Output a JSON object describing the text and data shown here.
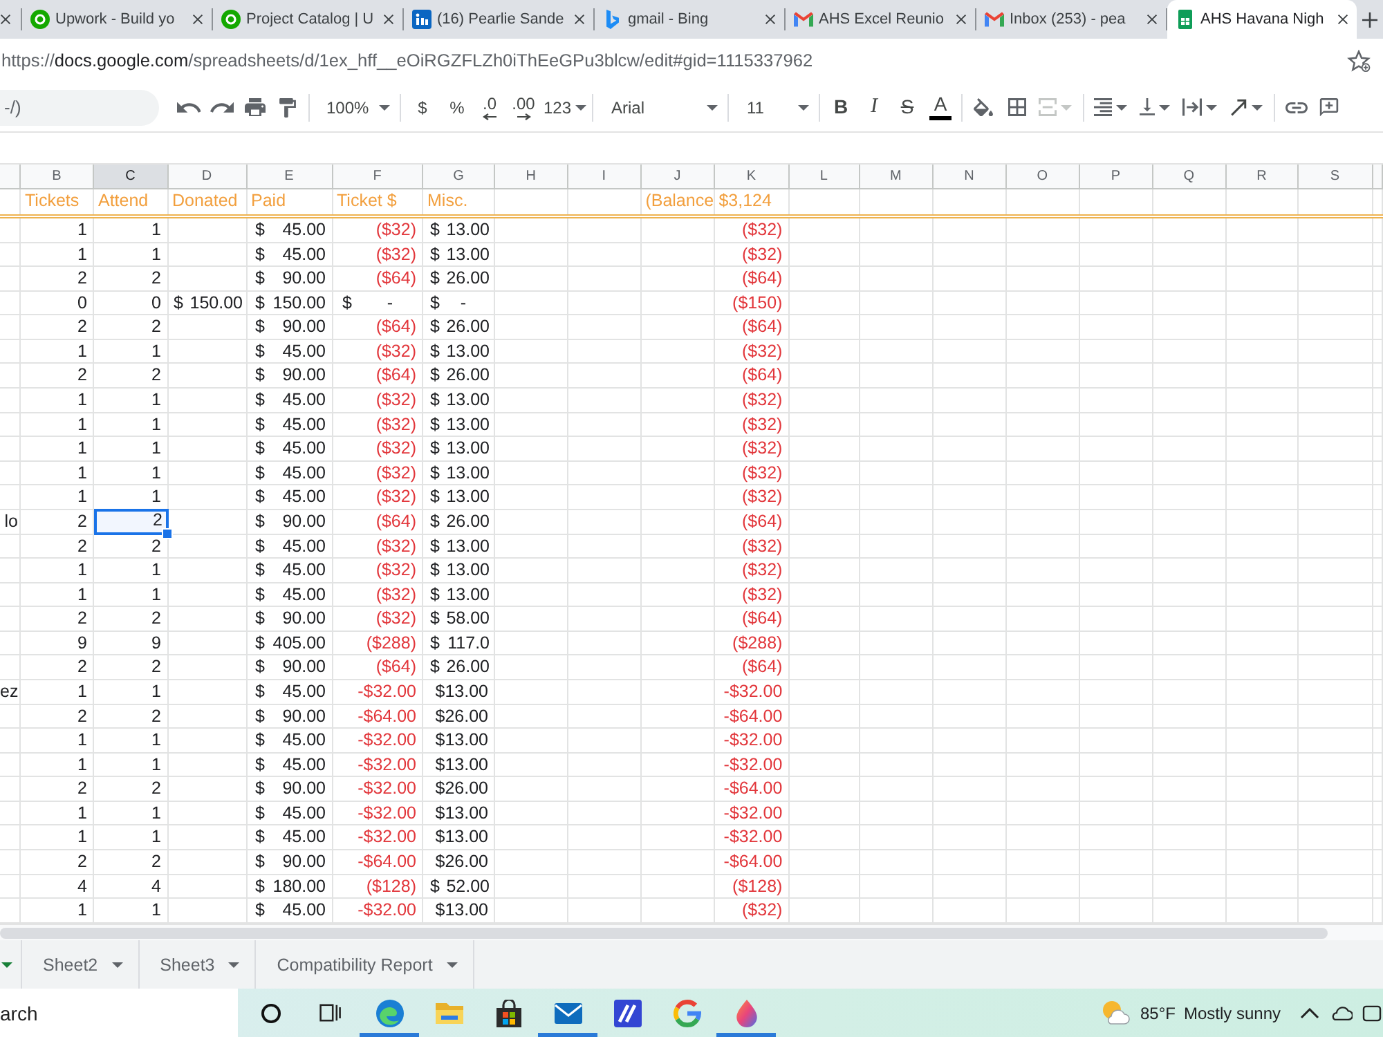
{
  "browser": {
    "tabs": [
      {
        "kind": "partial",
        "selected": false
      },
      {
        "title": "Upwork - Build yo",
        "kind": "circle",
        "selected": false
      },
      {
        "title": "Project Catalog | U",
        "kind": "circle",
        "selected": false
      },
      {
        "title": "(16) Pearlie Sande",
        "kind": "square",
        "selected": false
      },
      {
        "title": "gmail - Bing",
        "kind": "ribbon",
        "selected": false
      },
      {
        "title": "AHS Excel Reunio",
        "kind": "envelope",
        "selected": false
      },
      {
        "title": "Inbox (253) - pea",
        "kind": "envelope",
        "selected": false
      },
      {
        "title": "AHS Havana Nigh",
        "kind": "sheet",
        "selected": true
      }
    ],
    "address": {
      "scheme": "https://",
      "host": "docs.google.com",
      "path": "/spreadsheets/d/1ex_hff__eOiRGZFLZh0iThEeGPu3blcw/edit#gid=1115337962"
    }
  },
  "toolbar": {
    "menu_search": {
      "placeholder": "-/)"
    },
    "zoom": "100%",
    "number_formats": [
      {
        "label": "$",
        "kind": "plain"
      },
      {
        "label": "%",
        "kind": "plain"
      },
      {
        "label": ".0",
        "kind": "decrease"
      },
      {
        "label": ".00",
        "kind": "increase"
      },
      {
        "label": "123",
        "kind": "menu"
      }
    ],
    "font": "Arial",
    "font_size": "11",
    "text_styles": [
      {
        "label": "B",
        "kind": "bold"
      },
      {
        "label": "I",
        "kind": "italic"
      },
      {
        "label": "S",
        "kind": "strike"
      },
      {
        "label": "A",
        "kind": "color"
      }
    ],
    "merge": {
      "disabled": true
    }
  },
  "sheet": {
    "column_headers": [
      {
        "letter": "B",
        "selected": false
      },
      {
        "letter": "C",
        "selected": true
      },
      {
        "letter": "D",
        "selected": false
      },
      {
        "letter": "E",
        "selected": false
      },
      {
        "letter": "F",
        "selected": false
      },
      {
        "letter": "G",
        "selected": false
      },
      {
        "letter": "H",
        "selected": false
      },
      {
        "letter": "I",
        "selected": false
      },
      {
        "letter": "J",
        "selected": false
      },
      {
        "letter": "K",
        "selected": false
      },
      {
        "letter": "L",
        "selected": false
      },
      {
        "letter": "M",
        "selected": false
      },
      {
        "letter": "N",
        "selected": false
      },
      {
        "letter": "O",
        "selected": false
      },
      {
        "letter": "P",
        "selected": false
      },
      {
        "letter": "Q",
        "selected": false
      },
      {
        "letter": "R",
        "selected": false
      },
      {
        "letter": "S",
        "selected": false
      }
    ],
    "header_row": {
      "tickets": "Tickets",
      "attend": "Attend",
      "donated": "Donated",
      "paid": "Paid",
      "ticket_cost": "Ticket $",
      "misc": "Misc.",
      "balance_label": "(Balance",
      "balance": "$3,124"
    },
    "rows": [
      {
        "tickets": {
          "text": "1",
          "kind": "number",
          "selected": false
        },
        "attend": {
          "text": "1",
          "kind": "number",
          "selected": false
        },
        "paid": {
          "text": "$ 45.00",
          "kind": "accounting",
          "selected": false
        },
        "ticket_cost": {
          "text": "($32)",
          "kind": "negative",
          "selected": false
        },
        "misc": {
          "text": "$ 13.00",
          "kind": "accounting",
          "selected": false
        },
        "balance": {
          "text": "($32)",
          "kind": "negative",
          "selected": false
        }
      },
      {
        "tickets": {
          "text": "1",
          "kind": "number",
          "selected": false
        },
        "attend": {
          "text": "1",
          "kind": "number",
          "selected": false
        },
        "paid": {
          "text": "$ 45.00",
          "kind": "accounting",
          "selected": false
        },
        "ticket_cost": {
          "text": "($32)",
          "kind": "negative",
          "selected": false
        },
        "misc": {
          "text": "$ 13.00",
          "kind": "accounting",
          "selected": false
        },
        "balance": {
          "text": "($32)",
          "kind": "negative",
          "selected": false
        }
      },
      {
        "tickets": {
          "text": "2",
          "kind": "number",
          "selected": false
        },
        "attend": {
          "text": "2",
          "kind": "number",
          "selected": false
        },
        "paid": {
          "text": "$ 90.00",
          "kind": "accounting",
          "selected": false
        },
        "ticket_cost": {
          "text": "($64)",
          "kind": "negative",
          "selected": false
        },
        "misc": {
          "text": "$ 26.00",
          "kind": "accounting",
          "selected": false
        },
        "balance": {
          "text": "($64)",
          "kind": "negative",
          "selected": false
        }
      },
      {
        "tickets": {
          "text": "0",
          "kind": "number",
          "selected": false
        },
        "attend": {
          "text": "0",
          "kind": "number",
          "selected": false
        },
        "donated": {
          "text": "$ 150.00",
          "kind": "accounting",
          "selected": false
        },
        "paid": {
          "text": "$ 150.00",
          "kind": "accounting",
          "selected": false
        },
        "ticket_cost": {
          "text": "$ -",
          "kind": "zero",
          "selected": false
        },
        "misc": {
          "text": "$ -",
          "kind": "zero",
          "selected": false
        },
        "balance": {
          "text": "($150)",
          "kind": "negative",
          "selected": false
        }
      },
      {
        "tickets": {
          "text": "2",
          "kind": "number",
          "selected": false
        },
        "attend": {
          "text": "2",
          "kind": "number",
          "selected": false
        },
        "paid": {
          "text": "$ 90.00",
          "kind": "accounting",
          "selected": false
        },
        "ticket_cost": {
          "text": "($64)",
          "kind": "negative",
          "selected": false
        },
        "misc": {
          "text": "$ 26.00",
          "kind": "accounting",
          "selected": false
        },
        "balance": {
          "text": "($64)",
          "kind": "negative",
          "selected": false
        }
      },
      {
        "tickets": {
          "text": "1",
          "kind": "number",
          "selected": false
        },
        "attend": {
          "text": "1",
          "kind": "number",
          "selected": false
        },
        "paid": {
          "text": "$ 45.00",
          "kind": "accounting",
          "selected": false
        },
        "ticket_cost": {
          "text": "($32)",
          "kind": "negative",
          "selected": false
        },
        "misc": {
          "text": "$ 13.00",
          "kind": "accounting",
          "selected": false
        },
        "balance": {
          "text": "($32)",
          "kind": "negative",
          "selected": false
        }
      },
      {
        "tickets": {
          "text": "2",
          "kind": "number",
          "selected": false
        },
        "attend": {
          "text": "2",
          "kind": "number",
          "selected": false
        },
        "paid": {
          "text": "$ 90.00",
          "kind": "accounting",
          "selected": false
        },
        "ticket_cost": {
          "text": "($64)",
          "kind": "negative",
          "selected": false
        },
        "misc": {
          "text": "$ 26.00",
          "kind": "accounting",
          "selected": false
        },
        "balance": {
          "text": "($64)",
          "kind": "negative",
          "selected": false
        }
      },
      {
        "tickets": {
          "text": "1",
          "kind": "number",
          "selected": false
        },
        "attend": {
          "text": "1",
          "kind": "number",
          "selected": false
        },
        "paid": {
          "text": "$ 45.00",
          "kind": "accounting",
          "selected": false
        },
        "ticket_cost": {
          "text": "($32)",
          "kind": "negative",
          "selected": false
        },
        "misc": {
          "text": "$ 13.00",
          "kind": "accounting",
          "selected": false
        },
        "balance": {
          "text": "($32)",
          "kind": "negative",
          "selected": false
        }
      },
      {
        "tickets": {
          "text": "1",
          "kind": "number",
          "selected": false
        },
        "attend": {
          "text": "1",
          "kind": "number",
          "selected": false
        },
        "paid": {
          "text": "$ 45.00",
          "kind": "accounting",
          "selected": false
        },
        "ticket_cost": {
          "text": "($32)",
          "kind": "negative",
          "selected": false
        },
        "misc": {
          "text": "$ 13.00",
          "kind": "accounting",
          "selected": false
        },
        "balance": {
          "text": "($32)",
          "kind": "negative",
          "selected": false
        }
      },
      {
        "tickets": {
          "text": "1",
          "kind": "number",
          "selected": false
        },
        "attend": {
          "text": "1",
          "kind": "number",
          "selected": false
        },
        "paid": {
          "text": "$ 45.00",
          "kind": "accounting",
          "selected": false
        },
        "ticket_cost": {
          "text": "($32)",
          "kind": "negative",
          "selected": false
        },
        "misc": {
          "text": "$ 13.00",
          "kind": "accounting",
          "selected": false
        },
        "balance": {
          "text": "($32)",
          "kind": "negative",
          "selected": false
        }
      },
      {
        "tickets": {
          "text": "1",
          "kind": "number",
          "selected": false
        },
        "attend": {
          "text": "1",
          "kind": "number",
          "selected": false
        },
        "paid": {
          "text": "$ 45.00",
          "kind": "accounting",
          "selected": false
        },
        "ticket_cost": {
          "text": "($32)",
          "kind": "negative",
          "selected": false
        },
        "misc": {
          "text": "$ 13.00",
          "kind": "accounting",
          "selected": false
        },
        "balance": {
          "text": "($32)",
          "kind": "negative",
          "selected": false
        }
      },
      {
        "tickets": {
          "text": "1",
          "kind": "number",
          "selected": false
        },
        "attend": {
          "text": "1",
          "kind": "number",
          "selected": false
        },
        "paid": {
          "text": "$ 45.00",
          "kind": "accounting",
          "selected": false
        },
        "ticket_cost": {
          "text": "($32)",
          "kind": "negative",
          "selected": false
        },
        "misc": {
          "text": "$ 13.00",
          "kind": "accounting",
          "selected": false
        },
        "balance": {
          "text": "($32)",
          "kind": "negative",
          "selected": false
        }
      },
      {
        "column_a": "lo",
        "tickets": {
          "text": "2",
          "kind": "number",
          "selected": false
        },
        "attend": {
          "text": "2",
          "kind": "number",
          "selected": true
        },
        "paid": {
          "text": "$ 90.00",
          "kind": "accounting",
          "selected": false
        },
        "ticket_cost": {
          "text": "($64)",
          "kind": "negative",
          "selected": false
        },
        "misc": {
          "text": "$ 26.00",
          "kind": "accounting",
          "selected": false
        },
        "balance": {
          "text": "($64)",
          "kind": "negative",
          "selected": false
        }
      },
      {
        "tickets": {
          "text": "2",
          "kind": "number",
          "selected": false
        },
        "attend": {
          "text": "2",
          "kind": "number",
          "selected": false
        },
        "paid": {
          "text": "$ 45.00",
          "kind": "accounting",
          "selected": false
        },
        "ticket_cost": {
          "text": "($32)",
          "kind": "negative",
          "selected": false
        },
        "misc": {
          "text": "$ 13.00",
          "kind": "accounting",
          "selected": false
        },
        "balance": {
          "text": "($32)",
          "kind": "negative",
          "selected": false
        }
      },
      {
        "tickets": {
          "text": "1",
          "kind": "number",
          "selected": false
        },
        "attend": {
          "text": "1",
          "kind": "number",
          "selected": false
        },
        "paid": {
          "text": "$ 45.00",
          "kind": "accounting",
          "selected": false
        },
        "ticket_cost": {
          "text": "($32)",
          "kind": "negative",
          "selected": false
        },
        "misc": {
          "text": "$ 13.00",
          "kind": "accounting",
          "selected": false
        },
        "balance": {
          "text": "($32)",
          "kind": "negative",
          "selected": false
        }
      },
      {
        "tickets": {
          "text": "1",
          "kind": "number",
          "selected": false
        },
        "attend": {
          "text": "1",
          "kind": "number",
          "selected": false
        },
        "paid": {
          "text": "$ 45.00",
          "kind": "accounting",
          "selected": false
        },
        "ticket_cost": {
          "text": "($32)",
          "kind": "negative",
          "selected": false
        },
        "misc": {
          "text": "$ 13.00",
          "kind": "accounting",
          "selected": false
        },
        "balance": {
          "text": "($32)",
          "kind": "negative",
          "selected": false
        }
      },
      {
        "tickets": {
          "text": "2",
          "kind": "number",
          "selected": false
        },
        "attend": {
          "text": "2",
          "kind": "number",
          "selected": false
        },
        "paid": {
          "text": "$ 90.00",
          "kind": "accounting",
          "selected": false
        },
        "ticket_cost": {
          "text": "($32)",
          "kind": "negative",
          "selected": false
        },
        "misc": {
          "text": "$ 58.00",
          "kind": "accounting",
          "selected": false
        },
        "balance": {
          "text": "($64)",
          "kind": "negative",
          "selected": false
        }
      },
      {
        "tickets": {
          "text": "9",
          "kind": "number",
          "selected": false
        },
        "attend": {
          "text": "9",
          "kind": "number",
          "selected": false
        },
        "paid": {
          "text": "$ 405.00",
          "kind": "accounting",
          "selected": false
        },
        "ticket_cost": {
          "text": "($288)",
          "kind": "negative",
          "selected": false
        },
        "misc": {
          "text": "$ 117.0",
          "kind": "accounting",
          "selected": false
        },
        "balance": {
          "text": "($288)",
          "kind": "negative",
          "selected": false
        }
      },
      {
        "tickets": {
          "text": "2",
          "kind": "number",
          "selected": false
        },
        "attend": {
          "text": "2",
          "kind": "number",
          "selected": false
        },
        "paid": {
          "text": "$ 90.00",
          "kind": "accounting",
          "selected": false
        },
        "ticket_cost": {
          "text": "($64)",
          "kind": "negative",
          "selected": false
        },
        "misc": {
          "text": "$ 26.00",
          "kind": "accounting",
          "selected": false
        },
        "balance": {
          "text": "($64)",
          "kind": "negative",
          "selected": false
        }
      },
      {
        "column_a": "ez",
        "tickets": {
          "text": "1",
          "kind": "number",
          "selected": false
        },
        "attend": {
          "text": "1",
          "kind": "number",
          "selected": false
        },
        "paid": {
          "text": "$ 45.00",
          "kind": "accounting",
          "selected": false
        },
        "ticket_cost": {
          "text": "-$32.00",
          "kind": "negative",
          "selected": false
        },
        "misc": {
          "text": "$13.00",
          "kind": "number",
          "selected": false
        },
        "balance": {
          "text": "-$32.00",
          "kind": "negative",
          "selected": false
        }
      },
      {
        "tickets": {
          "text": "2",
          "kind": "number",
          "selected": false
        },
        "attend": {
          "text": "2",
          "kind": "number",
          "selected": false
        },
        "paid": {
          "text": "$ 90.00",
          "kind": "accounting",
          "selected": false
        },
        "ticket_cost": {
          "text": "-$64.00",
          "kind": "negative",
          "selected": false
        },
        "misc": {
          "text": "$26.00",
          "kind": "number",
          "selected": false
        },
        "balance": {
          "text": "-$64.00",
          "kind": "negative",
          "selected": false
        }
      },
      {
        "tickets": {
          "text": "1",
          "kind": "number",
          "selected": false
        },
        "attend": {
          "text": "1",
          "kind": "number",
          "selected": false
        },
        "paid": {
          "text": "$ 45.00",
          "kind": "accounting",
          "selected": false
        },
        "ticket_cost": {
          "text": "-$32.00",
          "kind": "negative",
          "selected": false
        },
        "misc": {
          "text": "$13.00",
          "kind": "number",
          "selected": false
        },
        "balance": {
          "text": "-$32.00",
          "kind": "negative",
          "selected": false
        }
      },
      {
        "tickets": {
          "text": "1",
          "kind": "number",
          "selected": false
        },
        "attend": {
          "text": "1",
          "kind": "number",
          "selected": false
        },
        "paid": {
          "text": "$ 45.00",
          "kind": "accounting",
          "selected": false
        },
        "ticket_cost": {
          "text": "-$32.00",
          "kind": "negative",
          "selected": false
        },
        "misc": {
          "text": "$13.00",
          "kind": "number",
          "selected": false
        },
        "balance": {
          "text": "-$32.00",
          "kind": "negative",
          "selected": false
        }
      },
      {
        "tickets": {
          "text": "2",
          "kind": "number",
          "selected": false
        },
        "attend": {
          "text": "2",
          "kind": "number",
          "selected": false
        },
        "paid": {
          "text": "$ 90.00",
          "kind": "accounting",
          "selected": false
        },
        "ticket_cost": {
          "text": "-$32.00",
          "kind": "negative",
          "selected": false
        },
        "misc": {
          "text": "$26.00",
          "kind": "number",
          "selected": false
        },
        "balance": {
          "text": "-$64.00",
          "kind": "negative",
          "selected": false
        }
      },
      {
        "tickets": {
          "text": "1",
          "kind": "number",
          "selected": false
        },
        "attend": {
          "text": "1",
          "kind": "number",
          "selected": false
        },
        "paid": {
          "text": "$ 45.00",
          "kind": "accounting",
          "selected": false
        },
        "ticket_cost": {
          "text": "-$32.00",
          "kind": "negative",
          "selected": false
        },
        "misc": {
          "text": "$13.00",
          "kind": "number",
          "selected": false
        },
        "balance": {
          "text": "-$32.00",
          "kind": "negative",
          "selected": false
        }
      },
      {
        "tickets": {
          "text": "1",
          "kind": "number",
          "selected": false
        },
        "attend": {
          "text": "1",
          "kind": "number",
          "selected": false
        },
        "paid": {
          "text": "$ 45.00",
          "kind": "accounting",
          "selected": false
        },
        "ticket_cost": {
          "text": "-$32.00",
          "kind": "negative",
          "selected": false
        },
        "misc": {
          "text": "$13.00",
          "kind": "number",
          "selected": false
        },
        "balance": {
          "text": "-$32.00",
          "kind": "negative",
          "selected": false
        }
      },
      {
        "tickets": {
          "text": "2",
          "kind": "number",
          "selected": false
        },
        "attend": {
          "text": "2",
          "kind": "number",
          "selected": false
        },
        "paid": {
          "text": "$ 90.00",
          "kind": "accounting",
          "selected": false
        },
        "ticket_cost": {
          "text": "-$64.00",
          "kind": "negative",
          "selected": false
        },
        "misc": {
          "text": "$26.00",
          "kind": "number",
          "selected": false
        },
        "balance": {
          "text": "-$64.00",
          "kind": "negative",
          "selected": false
        }
      },
      {
        "tickets": {
          "text": "4",
          "kind": "number",
          "selected": false
        },
        "attend": {
          "text": "4",
          "kind": "number",
          "selected": false
        },
        "paid": {
          "text": "$ 180.00",
          "kind": "accounting",
          "selected": false
        },
        "ticket_cost": {
          "text": "($128)",
          "kind": "negative",
          "selected": false
        },
        "misc": {
          "text": "$ 52.00",
          "kind": "accounting",
          "selected": false
        },
        "balance": {
          "text": "($128)",
          "kind": "negative",
          "selected": false
        }
      },
      {
        "tickets": {
          "text": "1",
          "kind": "number",
          "selected": false
        },
        "attend": {
          "text": "1",
          "kind": "number",
          "selected": false
        },
        "paid": {
          "text": "$ 45.00",
          "kind": "accounting",
          "selected": false
        },
        "ticket_cost": {
          "text": "-$32.00",
          "kind": "negative",
          "selected": false
        },
        "misc": {
          "text": "$13.00",
          "kind": "number",
          "selected": false
        },
        "balance": {
          "text": "($32)",
          "kind": "negative",
          "selected": false
        }
      }
    ]
  },
  "sheet_tabs": [
    {
      "selected": true
    },
    {
      "label": "Sheet2",
      "selected": false
    },
    {
      "label": "Sheet3",
      "selected": false
    },
    {
      "label": "Compatibility Report",
      "selected": false
    }
  ],
  "taskbar": {
    "search": {
      "placeholder": "arch"
    },
    "apps": [
      {
        "kind": "ring",
        "running": false
      },
      {
        "kind": "taskview",
        "running": false
      },
      {
        "kind": "browser",
        "running": true
      },
      {
        "kind": "folder",
        "running": false
      },
      {
        "kind": "bag",
        "running": false
      },
      {
        "kind": "mail",
        "running": true
      },
      {
        "kind": "stripes",
        "running": false
      },
      {
        "kind": "google",
        "running": false
      },
      {
        "kind": "drop",
        "running": true
      }
    ],
    "weather": {
      "temperature": "85°F",
      "condition": "Mostly sunny"
    }
  }
}
